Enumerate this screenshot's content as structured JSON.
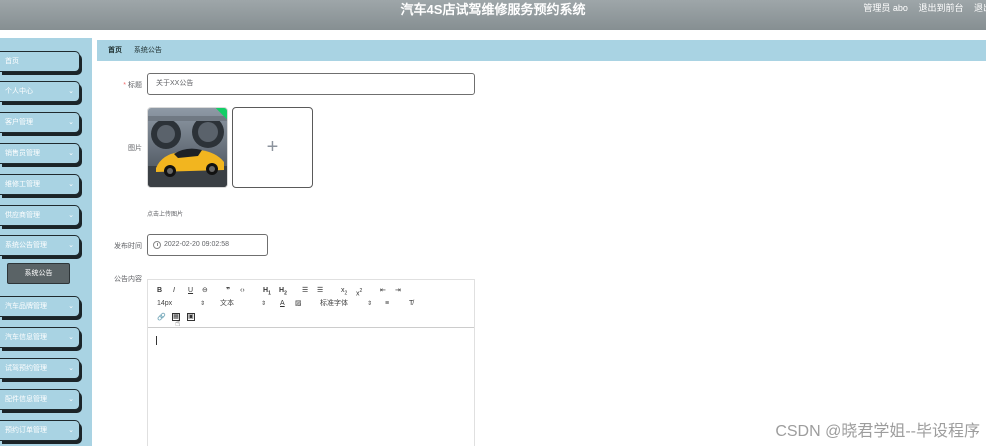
{
  "header": {
    "title": "汽车4S店试驾维修服务预约系统",
    "user_label": "管理员 abo",
    "back_label": "退出到前台",
    "logout_label": "退出"
  },
  "sidebar": {
    "items": [
      {
        "label": "首页",
        "has_chevron": false
      },
      {
        "label": "个人中心",
        "has_chevron": true
      },
      {
        "label": "客户管理",
        "has_chevron": true
      },
      {
        "label": "销售员管理",
        "has_chevron": true
      },
      {
        "label": "维修工管理",
        "has_chevron": true
      },
      {
        "label": "供应商管理",
        "has_chevron": true
      },
      {
        "label": "系统公告管理",
        "has_chevron": true
      },
      {
        "label": "汽车品牌管理",
        "has_chevron": true
      },
      {
        "label": "汽车信息管理",
        "has_chevron": true
      },
      {
        "label": "试驾预约管理",
        "has_chevron": true
      },
      {
        "label": "配件信息管理",
        "has_chevron": true
      },
      {
        "label": "预约订单管理",
        "has_chevron": true
      }
    ],
    "active_sub": "系统公告"
  },
  "breadcrumb": {
    "home": "首页",
    "current": "系统公告"
  },
  "form": {
    "title_label": "标题",
    "title_value": "关于XX公告",
    "image_label": "图片",
    "upload_tip": "点击上传图片",
    "publish_time_label": "发布时间",
    "publish_time_value": "2022-02-20 09:02:58",
    "content_label": "公告内容"
  },
  "editor": {
    "font_size": "14px",
    "text_type": "文本",
    "font_family": "标准字体"
  },
  "watermark": "CSDN @晓君学姐--毕设程序",
  "colors": {
    "header_bg": "#8e979a",
    "sidebar_bg": "#a9d3e3",
    "active_sub_bg": "#5a6366",
    "success_badge": "#13ce66"
  }
}
